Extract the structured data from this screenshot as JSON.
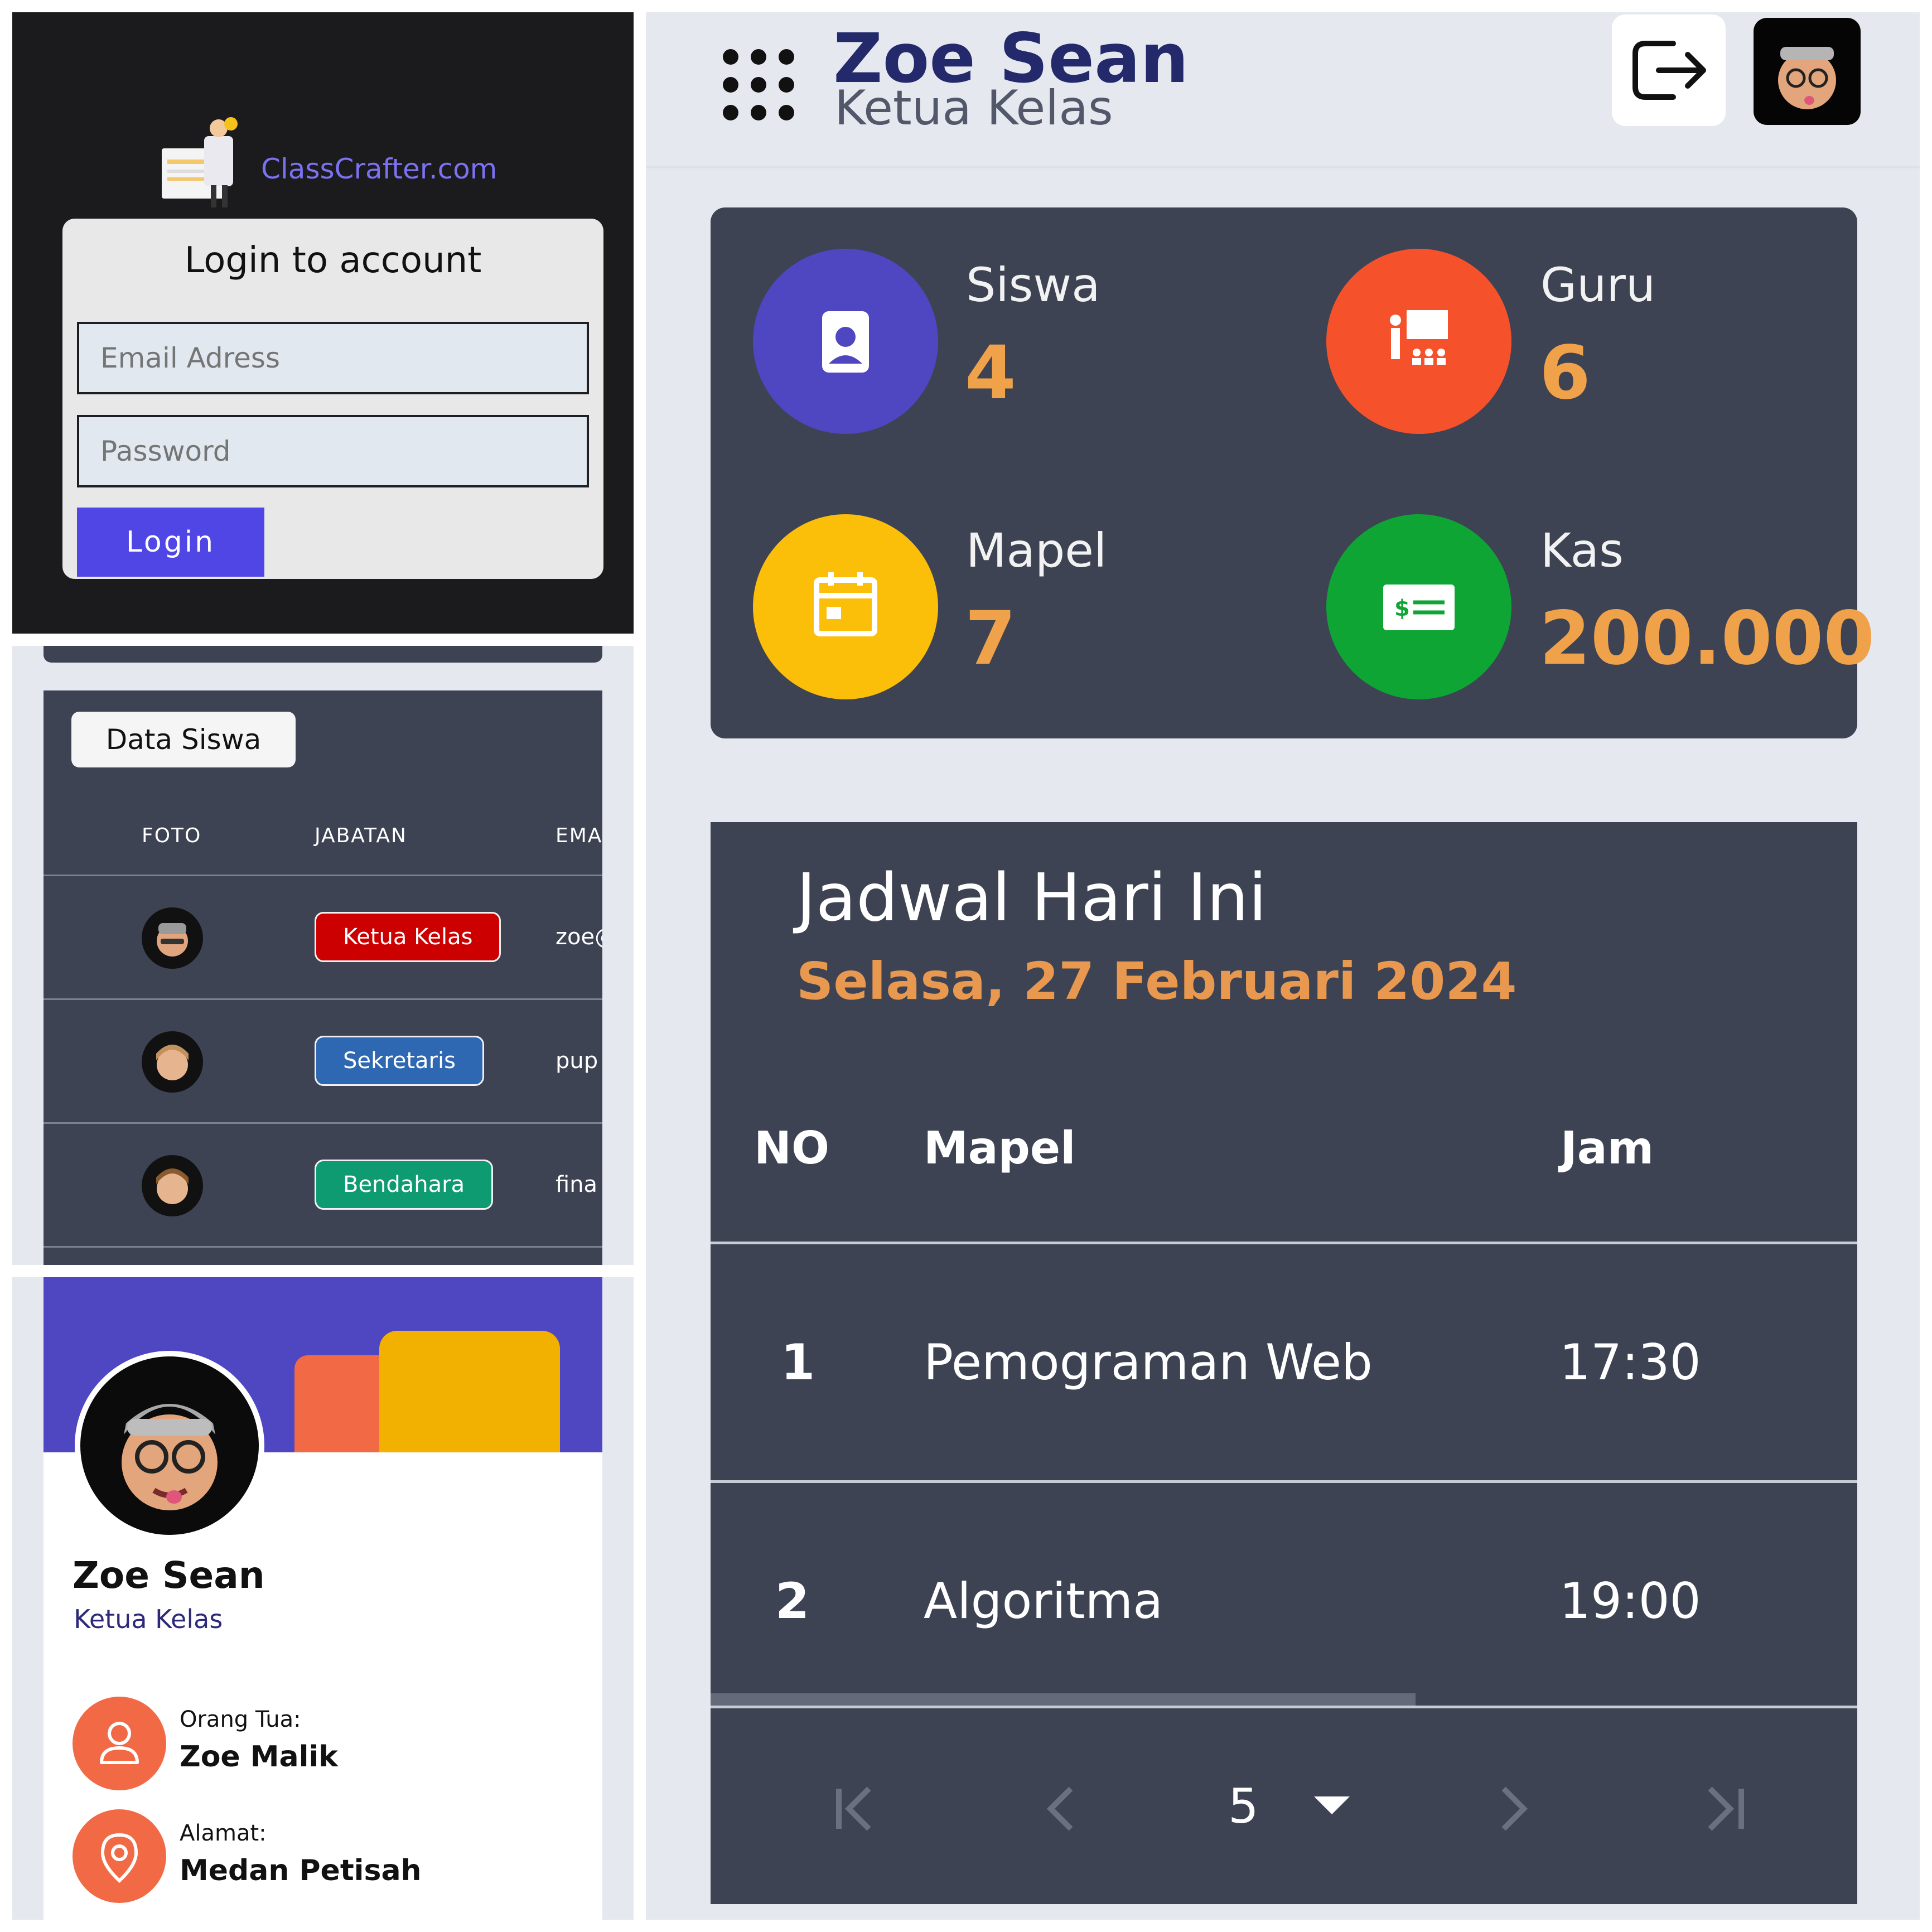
{
  "login": {
    "brand": "ClassCrafter.com",
    "title": "Login to account",
    "email_placeholder": "Email Adress",
    "password_placeholder": "Password",
    "button": "Login"
  },
  "siswa": {
    "title": "Data Siswa",
    "columns": [
      "FOTO",
      "JABATAN",
      "EMAI"
    ],
    "rows": [
      {
        "jabatan": "Ketua Kelas",
        "badge_color": "#cc0000",
        "email": "zoe@"
      },
      {
        "jabatan": "Sekretaris",
        "badge_color": "#2e67b2",
        "email": "pup"
      },
      {
        "jabatan": "Bendahara",
        "badge_color": "#0f9b72",
        "email": "fina"
      }
    ]
  },
  "profile": {
    "name": "Zoe Sean",
    "role": "Ketua Kelas",
    "parent_label": "Orang Tua:",
    "parent_value": "Zoe Malik",
    "address_label": "Alamat:",
    "address_value": "Medan Petisah"
  },
  "header": {
    "name": "Zoe Sean",
    "role": "Ketua Kelas"
  },
  "stats": [
    {
      "label": "Siswa",
      "value": "4",
      "color": "#4f46c2",
      "icon": "student-card-icon"
    },
    {
      "label": "Guru",
      "value": "6",
      "color": "#f5522b",
      "icon": "teacher-board-icon"
    },
    {
      "label": "Mapel",
      "value": "7",
      "color": "#fbbf0a",
      "icon": "calendar-icon"
    },
    {
      "label": "Kas",
      "value": "200.000",
      "color": "#0ea534",
      "icon": "money-icon"
    }
  ],
  "jadwal": {
    "title": "Jadwal Hari Ini",
    "date": "Selasa, 27 Februari 2024",
    "columns": {
      "no": "NO",
      "mapel": "Mapel",
      "jam": "Jam"
    },
    "rows": [
      {
        "no": "1",
        "mapel": "Pemograman Web",
        "jam": "17:30"
      },
      {
        "no": "2",
        "mapel": "Algoritma",
        "jam": "19:00"
      }
    ],
    "page_size": "5"
  },
  "colors": {
    "accent": "#4f46e5",
    "dark": "#3e4354",
    "orange_value": "#f0a24a"
  }
}
